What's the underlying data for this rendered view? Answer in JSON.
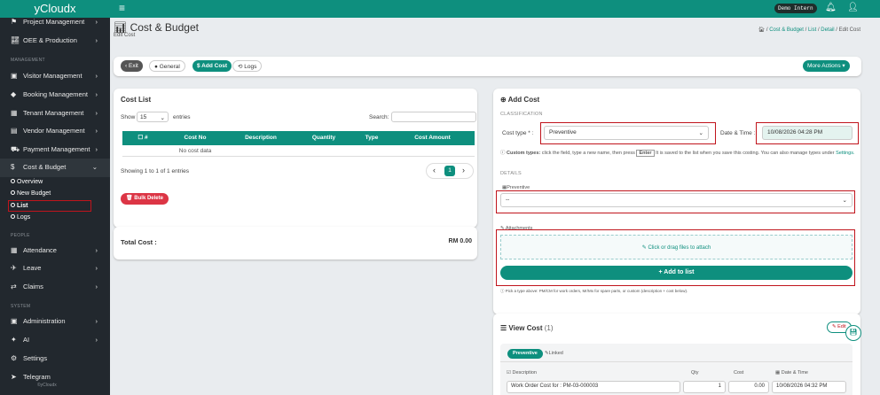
{
  "topbar": {
    "brand": "yCloudx",
    "menu_icon": "hamburger-icon",
    "user": "Demo Intern",
    "bell_icon": "bell-icon",
    "user_icon": "user-icon"
  },
  "sidebar": {
    "items_top": [
      {
        "label": "Project Management",
        "icon": "project-icon"
      },
      {
        "label": "OEE & Production",
        "icon": "chart-icon"
      }
    ],
    "heading_management": "MANAGEMENT",
    "management": [
      {
        "label": "Visitor Management",
        "icon": "id-card-icon"
      },
      {
        "label": "Booking Management",
        "icon": "tag-icon"
      },
      {
        "label": "Tenant Management",
        "icon": "building-icon"
      },
      {
        "label": "Vendor Management",
        "icon": "vendor-icon"
      },
      {
        "label": "Payment Management",
        "icon": "cart-icon"
      },
      {
        "label": "Cost & Budget",
        "icon": "dollar-icon"
      }
    ],
    "cost_sub": [
      "Overview",
      "New Budget",
      "List",
      "Logs"
    ],
    "heading_people": "PEOPLE",
    "people": [
      {
        "label": "Attendance",
        "icon": "calendar-icon"
      },
      {
        "label": "Leave",
        "icon": "plane-icon"
      },
      {
        "label": "Claims",
        "icon": "exchange-icon"
      }
    ],
    "heading_system": "SYSTEM",
    "system": [
      {
        "label": "Administration",
        "icon": "admin-icon"
      },
      {
        "label": "AI",
        "icon": "ai-icon"
      },
      {
        "label": "Settings",
        "icon": "gear-icon"
      },
      {
        "label": "Telegram",
        "icon": "telegram-icon"
      }
    ],
    "footer": "©yCloudx"
  },
  "page": {
    "title": "Cost & Budget",
    "subtitle": "Edit Cost",
    "crumbs": [
      "Cost & Budget",
      "List",
      "Detail",
      "Edit Cost"
    ]
  },
  "toolbar": {
    "exit": "Exit",
    "general": "General",
    "add_cost": "$ Add Cost",
    "logs": "Logs",
    "more_actions": "More Actions ▾"
  },
  "cost_list": {
    "title": "Cost List",
    "show": "Show",
    "entries_value": "15",
    "entries": "entries",
    "search": "Search:",
    "columns": [
      "#",
      "Cost No",
      "Description",
      "Quantity",
      "Type",
      "Cost Amount"
    ],
    "empty": "No cost data",
    "info": "Showing 1 to 1 of 1 entries",
    "page": "1",
    "bulk_delete": "Bulk Delete"
  },
  "total": {
    "label": "Total Cost :",
    "value": "RM 0.00"
  },
  "add_cost": {
    "title": "Add Cost",
    "classification": "CLASSIFICATION",
    "cost_type_label": "Cost type *",
    "cost_type_value": "Preventive",
    "date_label": "Date & Time",
    "date_value": "10/08/2026 04:28 PM",
    "custom_note_a": "Custom types:",
    "custom_note_b": "click the field, type a new name, then press",
    "enter": "Enter",
    "custom_note_c": "It is saved to the list when you save this costing. You can also manage types under",
    "settings_link": "Settings.",
    "details": "DETAILS",
    "preventive_label": "Preventive",
    "select_placeholder": "--",
    "attachments": "Attachments",
    "attach_hint": "Click or drag files to attach",
    "add_to_list": "+ Add to list",
    "footnote": "Pick a type above: PM/CM for work orders, Mr/Mx for spare parts, or custom (description + cost below)."
  },
  "view_cost": {
    "title": "View Cost",
    "count": "(1)",
    "edit": "Edit",
    "tab_active": "Preventive",
    "tab_linked": "Linked",
    "col_desc": "Description",
    "col_qty": "Qty",
    "col_cost": "Cost",
    "col_date": "Date & Time",
    "row_desc": "Work Order Cost for : PM-03-000003",
    "row_qty": "1",
    "row_cost": "0.00",
    "row_date": "10/08/2026 04:32 PM"
  },
  "colors": {
    "primary": "#0e8f7e",
    "sidebar": "#22282e",
    "danger": "#dc3545",
    "highlight": "#c0141c"
  }
}
